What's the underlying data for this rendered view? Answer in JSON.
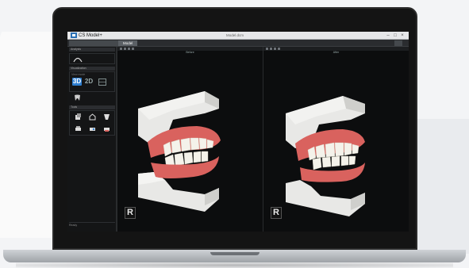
{
  "app": {
    "title": "CS Model+",
    "file_title": "Model.dcm",
    "controls": [
      "–",
      "□",
      "×"
    ]
  },
  "tabs": [
    {
      "label": ""
    },
    {
      "label": "Model"
    }
  ],
  "sidebar": {
    "panels": [
      {
        "header": "Analysis"
      },
      {
        "header": "Visualization",
        "sub": "View mode"
      },
      {
        "header": "Tools"
      }
    ],
    "view_modes": [
      "3D",
      "2D"
    ],
    "status": "Ready"
  },
  "viewports": [
    {
      "label": "Before",
      "badge": "R"
    },
    {
      "label": "After",
      "badge": "R"
    }
  ],
  "colors": {
    "accent": "#2f7fd0",
    "gum": "#d9625e",
    "tooth": "#f4f2ea",
    "base": "#e8e8e6"
  },
  "icons": [
    "app-logo-icon",
    "arch-icon",
    "grid-icon",
    "tooth-icon",
    "printer-icon",
    "box-icon"
  ]
}
